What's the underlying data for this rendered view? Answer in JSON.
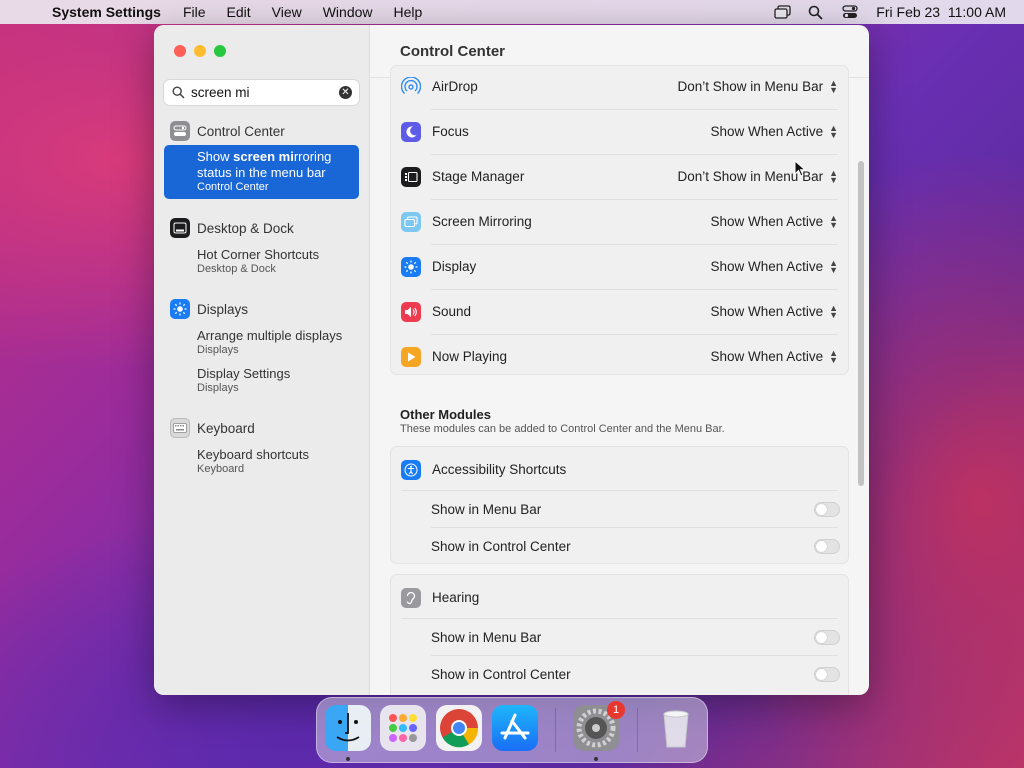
{
  "menubar": {
    "app_name": "System Settings",
    "items": [
      "File",
      "Edit",
      "View",
      "Window",
      "Help"
    ],
    "clock": "Fri Feb 23  11:00 AM"
  },
  "sidebar": {
    "search_value": "screen mi",
    "groups": [
      {
        "label": "Control Center"
      },
      {
        "label": "Desktop & Dock"
      },
      {
        "label": "Displays"
      },
      {
        "label": "Keyboard"
      }
    ],
    "selected": {
      "line1_pre": "Show ",
      "line1_hl": "screen mi",
      "line1_post": "rroring",
      "line2": "status in the menu bar",
      "sub": "Control Center"
    },
    "results": [
      {
        "label": "Hot Corner Shortcuts",
        "sub": "Desktop & Dock"
      },
      {
        "label": "Arrange multiple displays",
        "sub": "Displays"
      },
      {
        "label": "Display Settings",
        "sub": "Displays"
      },
      {
        "label": "Keyboard shortcuts",
        "sub": "Keyboard"
      }
    ]
  },
  "main": {
    "title": "Control Center",
    "modules": [
      {
        "name": "AirDrop",
        "value": "Don’t Show in Menu Bar"
      },
      {
        "name": "Focus",
        "value": "Show When Active"
      },
      {
        "name": "Stage Manager",
        "value": "Don’t Show in Menu Bar"
      },
      {
        "name": "Screen Mirroring",
        "value": "Show When Active"
      },
      {
        "name": "Display",
        "value": "Show When Active"
      },
      {
        "name": "Sound",
        "value": "Show When Active"
      },
      {
        "name": "Now Playing",
        "value": "Show When Active"
      }
    ],
    "other_title": "Other Modules",
    "other_sub": "These modules can be added to Control Center and the Menu Bar.",
    "accessibility": {
      "name": "Accessibility Shortcuts",
      "opt1": "Show in Menu Bar",
      "opt2": "Show in Control Center"
    },
    "hearing": {
      "name": "Hearing",
      "opt1": "Show in Menu Bar",
      "opt2": "Show in Control Center"
    }
  },
  "dock": {
    "badge_count": "1"
  }
}
